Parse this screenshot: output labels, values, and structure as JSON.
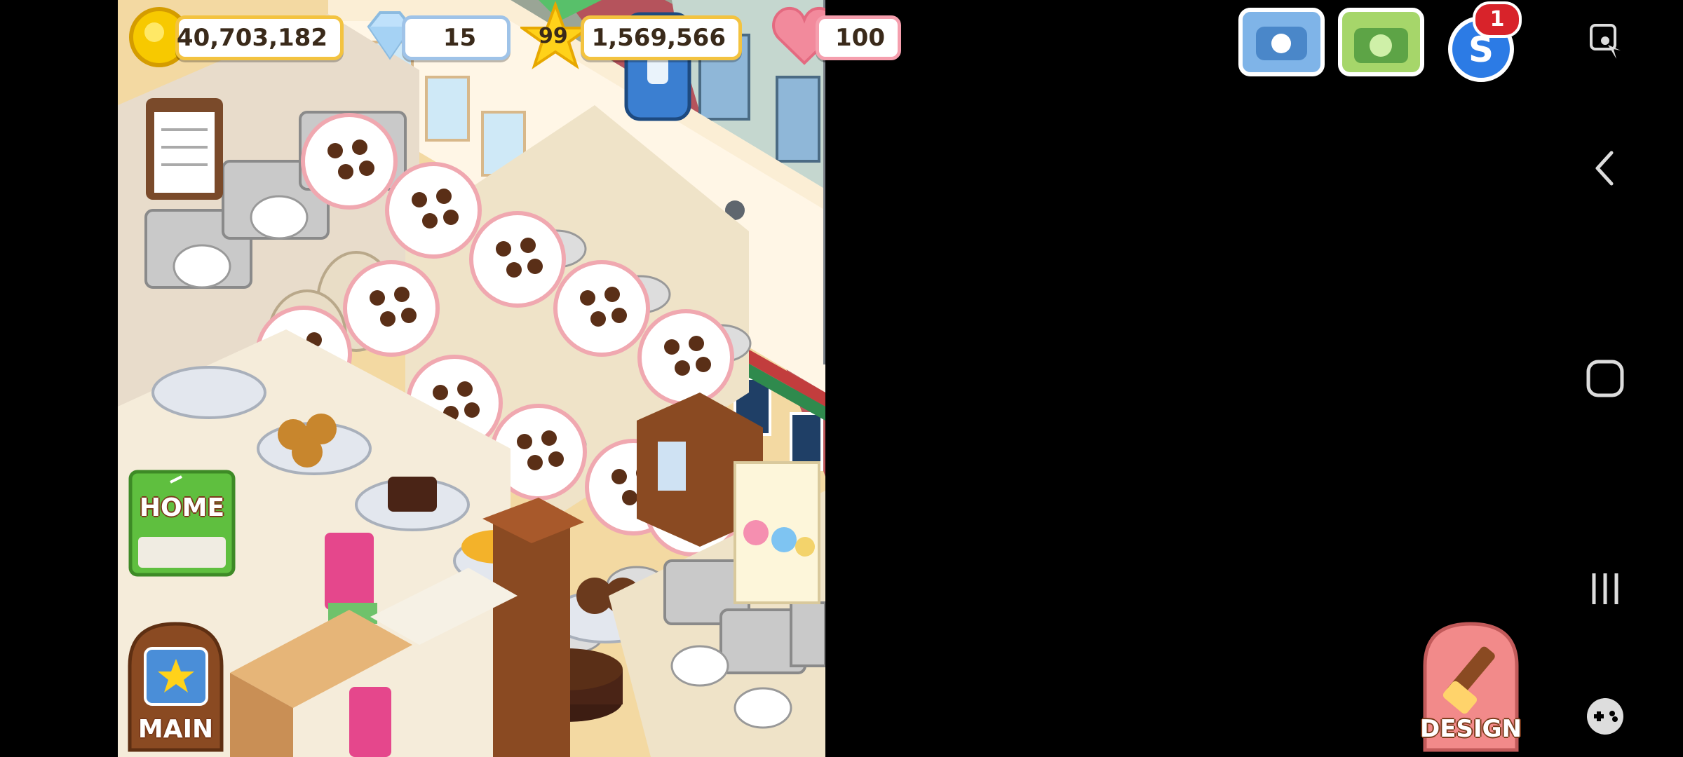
{
  "hud": {
    "coins": "40,703,182",
    "gems": "15",
    "level": "99",
    "experience": "1,569,566",
    "hearts": "100",
    "notifications": "1"
  },
  "buttons": {
    "home": "HOME",
    "main": "MAIN",
    "design": "DESIGN"
  },
  "colors": {
    "coin": "#f7c900",
    "gem": "#bfe1fb",
    "star": "#ffd21a",
    "heart": "#f28a9c",
    "wall": "#fff6e6",
    "street": "#9aa596",
    "sidewalk": "#b84a55"
  },
  "nav": {
    "icons": [
      "game-tools-icon",
      "back-icon",
      "home-icon",
      "recents-icon",
      "game-launcher-icon"
    ]
  }
}
